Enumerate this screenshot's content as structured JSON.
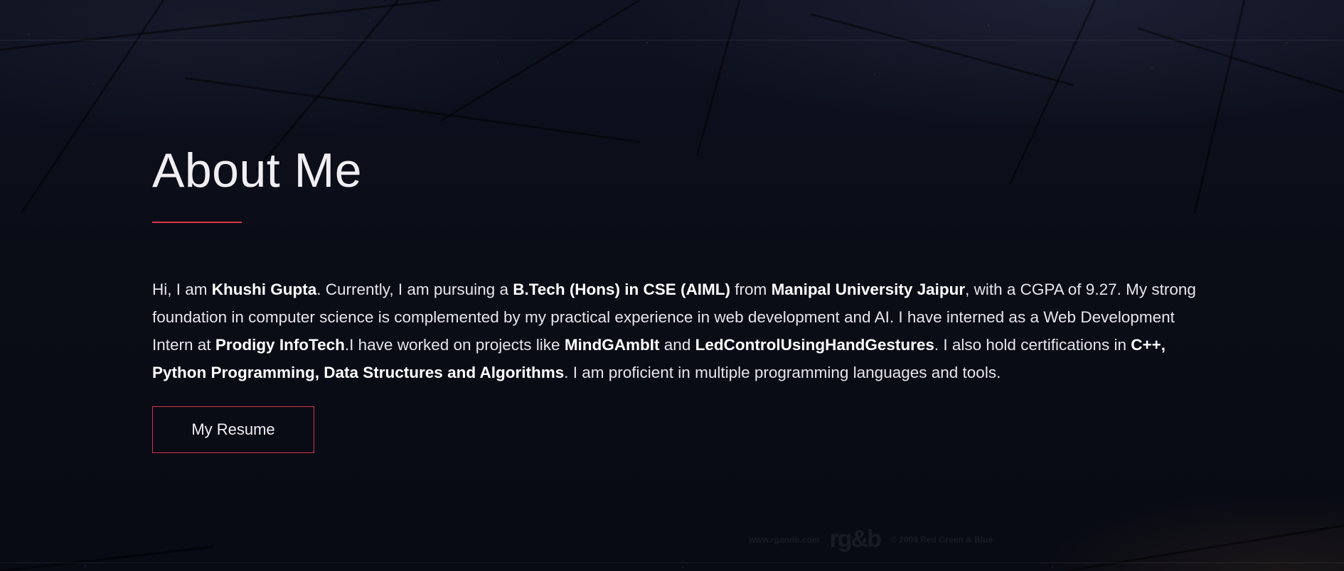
{
  "about": {
    "title": "About Me",
    "accent_color": "#e0354d",
    "paragraph": [
      {
        "text": "Hi, I am ",
        "bold": false
      },
      {
        "text": "Khushi Gupta",
        "bold": true
      },
      {
        "text": ". Currently, I am pursuing a ",
        "bold": false
      },
      {
        "text": "B.Tech (Hons) in CSE (AIML)",
        "bold": true
      },
      {
        "text": " from ",
        "bold": false
      },
      {
        "text": "Manipal University Jaipur",
        "bold": true
      },
      {
        "text": ", with a CGPA of 9.27. My strong foundation in computer science is complemented by my practical experience in web development and AI. I have interned as a Web Development Intern at ",
        "bold": false
      },
      {
        "text": "Prodigy InfoTech",
        "bold": true
      },
      {
        "text": ".I have worked on projects like ",
        "bold": false
      },
      {
        "text": "MindGAmbIt",
        "bold": true
      },
      {
        "text": " and ",
        "bold": false
      },
      {
        "text": "LedControlUsingHandGestures",
        "bold": true
      },
      {
        "text": ". I also hold certifications in ",
        "bold": false
      },
      {
        "text": "C++, Python Programming, Data Structures and Algorithms",
        "bold": true
      },
      {
        "text": ". I am proficient in multiple programming languages and tools.",
        "bold": false
      }
    ],
    "resume_button_label": "My Resume"
  },
  "watermark": {
    "site": "www.rgandb.com",
    "logo": "rg&b",
    "copyright": "© 2009 Red Green & Blue"
  }
}
